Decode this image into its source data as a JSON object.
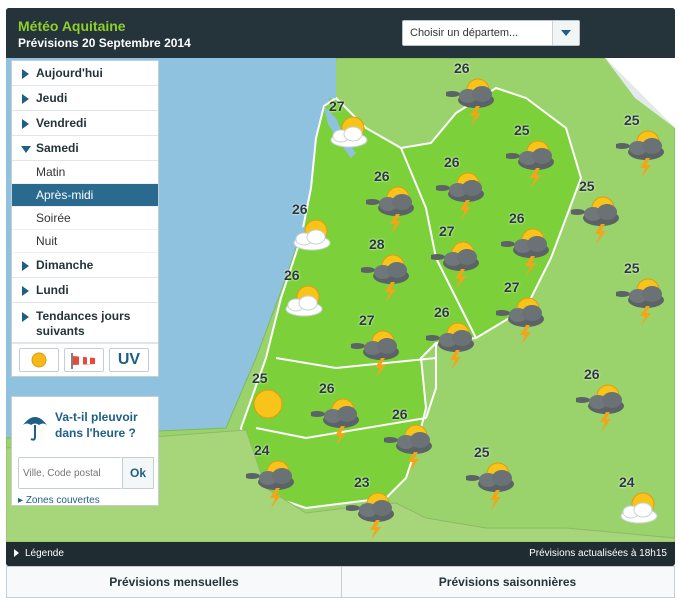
{
  "header": {
    "title": "Météo Aquitaine",
    "subtitle": "Prévisions 20 Septembre 2014",
    "select_label": "Choisir un départem..."
  },
  "nav": {
    "items": [
      {
        "label": "Aujourd'hui"
      },
      {
        "label": "Jeudi"
      },
      {
        "label": "Vendredi"
      },
      {
        "label": "Samedi",
        "expanded": true,
        "sub": [
          "Matin",
          "Après-midi",
          "Soirée",
          "Nuit"
        ],
        "active_sub": "Après-midi"
      },
      {
        "label": "Dimanche"
      },
      {
        "label": "Lundi"
      },
      {
        "label": "Tendances jours suivants"
      }
    ],
    "icons": [
      "sun-icon",
      "windsock-icon",
      "UV"
    ]
  },
  "rain": {
    "question": "Va-t-il pleuvoir dans l'heure ?",
    "placeholder": "Ville, Code postal",
    "ok": "Ok",
    "zones": "Zones couvertes"
  },
  "footer": {
    "legend": "Légende",
    "updated": "Prévisions actualisées à 18h15"
  },
  "tabs": {
    "monthly": "Prévisions mensuelles",
    "seasonal": "Prévisions saisonnières"
  },
  "forecasts": [
    {
      "temp": "26",
      "icon": "storm"
    },
    {
      "temp": "27",
      "icon": "sun-cloud"
    },
    {
      "temp": "25",
      "icon": "storm"
    },
    {
      "temp": "25",
      "icon": "storm"
    },
    {
      "temp": "26",
      "icon": "storm"
    },
    {
      "temp": "26",
      "icon": "storm"
    },
    {
      "temp": "25",
      "icon": "storm"
    },
    {
      "temp": "26",
      "icon": "sun-cloud"
    },
    {
      "temp": "26",
      "icon": "storm"
    },
    {
      "temp": "27",
      "icon": "storm"
    },
    {
      "temp": "28",
      "icon": "storm"
    },
    {
      "temp": "26",
      "icon": "sun-cloud"
    },
    {
      "temp": "25",
      "icon": "storm"
    },
    {
      "temp": "27",
      "icon": "storm"
    },
    {
      "temp": "27",
      "icon": "storm"
    },
    {
      "temp": "26",
      "icon": "storm"
    },
    {
      "temp": "25",
      "icon": "sun"
    },
    {
      "temp": "26",
      "icon": "storm"
    },
    {
      "temp": "26",
      "icon": "storm"
    },
    {
      "temp": "26",
      "icon": "storm"
    },
    {
      "temp": "24",
      "icon": "storm"
    },
    {
      "temp": "25",
      "icon": "storm"
    },
    {
      "temp": "23",
      "icon": "storm"
    },
    {
      "temp": "24",
      "icon": "sun-cloud"
    }
  ],
  "colors": {
    "header_bg": "#24343a",
    "title": "#8fcf2a",
    "land": "#8fd05a",
    "highlight_land": "#6fc83e",
    "sea": "#8fc2de",
    "accent": "#1e5f86"
  }
}
